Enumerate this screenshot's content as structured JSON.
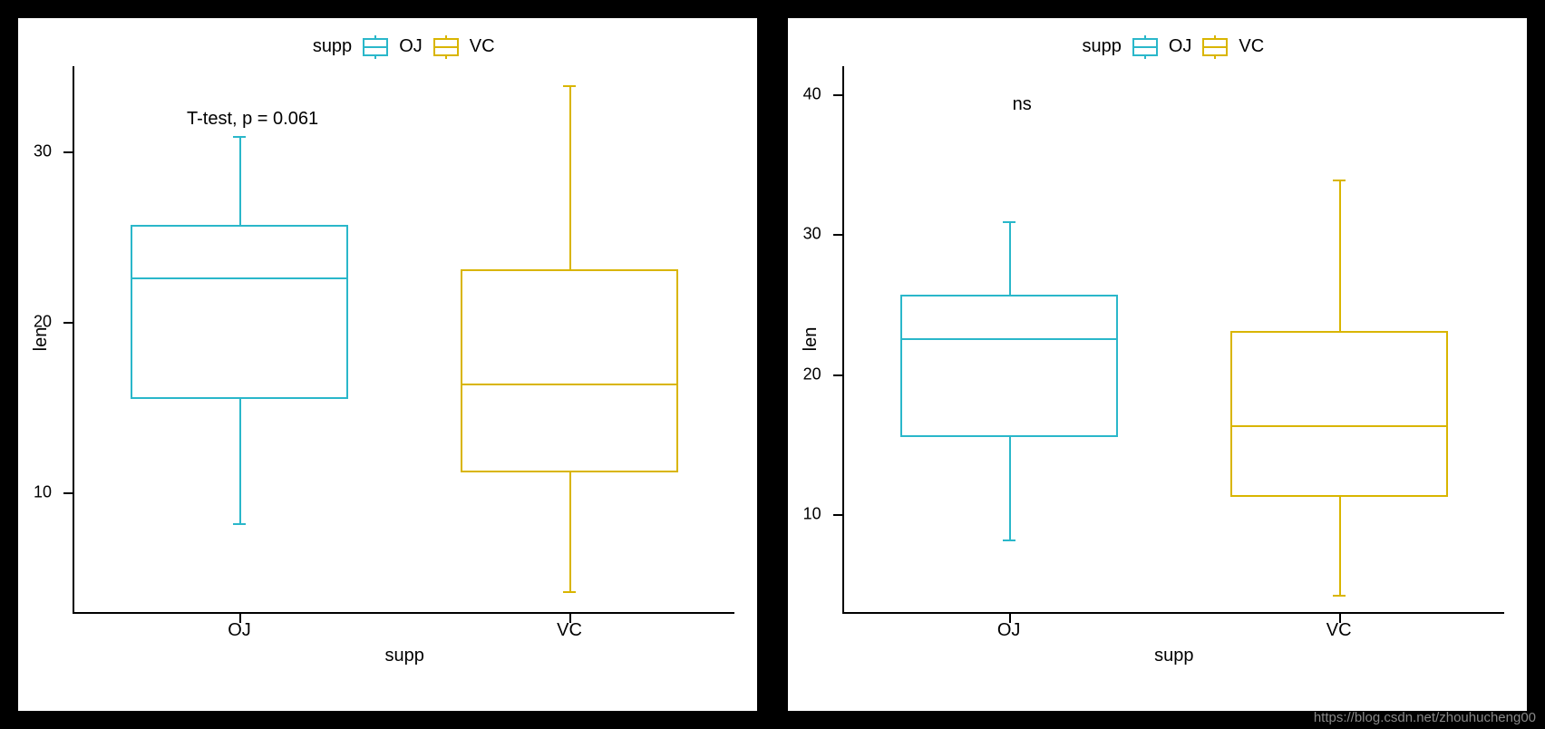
{
  "chart_data": [
    {
      "type": "boxplot",
      "title_annotation": "T-test, p = 0.061",
      "xlabel": "supp",
      "ylabel": "len",
      "legend_title": "supp",
      "y_ticks": [
        10,
        20,
        30
      ],
      "ylim": [
        3,
        35
      ],
      "categories": [
        "OJ",
        "VC"
      ],
      "series": [
        {
          "name": "OJ",
          "color": "#2ab7ca",
          "min": 8.2,
          "q1": 15.5,
          "median": 22.7,
          "q3": 25.7,
          "max": 30.9
        },
        {
          "name": "VC",
          "color": "#d9b500",
          "min": 4.2,
          "q1": 11.2,
          "median": 16.5,
          "q3": 23.1,
          "max": 33.9
        }
      ]
    },
    {
      "type": "boxplot",
      "title_annotation": "ns",
      "xlabel": "supp",
      "ylabel": "len",
      "legend_title": "supp",
      "y_ticks": [
        10,
        20,
        30,
        40
      ],
      "ylim": [
        3,
        42
      ],
      "categories": [
        "OJ",
        "VC"
      ],
      "series": [
        {
          "name": "OJ",
          "color": "#2ab7ca",
          "min": 8.2,
          "q1": 15.5,
          "median": 22.7,
          "q3": 25.7,
          "max": 30.9
        },
        {
          "name": "VC",
          "color": "#d9b500",
          "min": 4.2,
          "q1": 11.2,
          "median": 16.5,
          "q3": 23.1,
          "max": 33.9
        }
      ]
    }
  ],
  "watermark": "https://blog.csdn.net/zhouhucheng00"
}
